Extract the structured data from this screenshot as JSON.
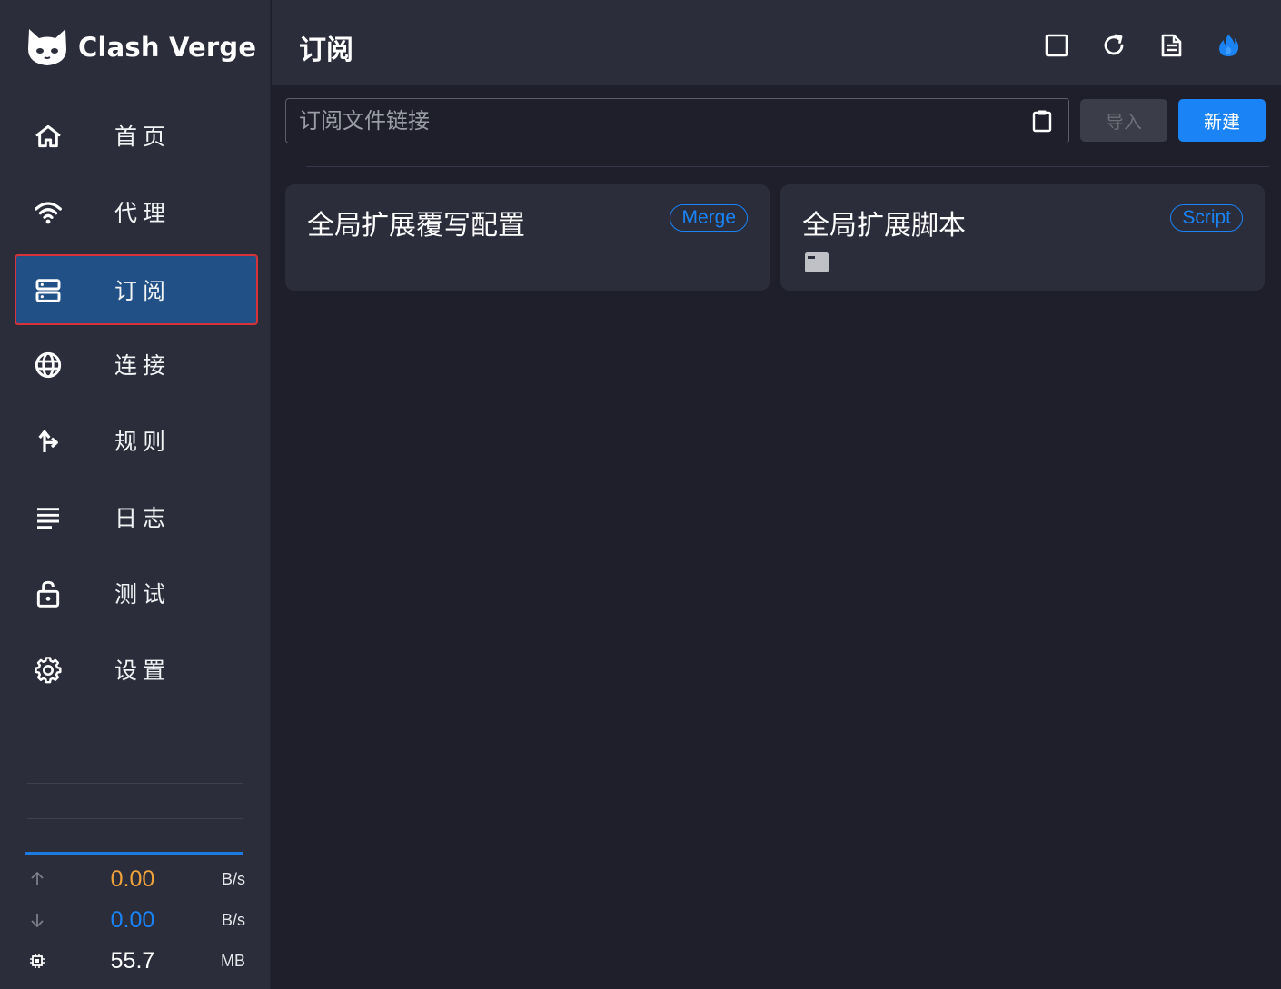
{
  "app": {
    "title": "Clash Verge"
  },
  "sidebar": {
    "items": [
      {
        "label": "首页",
        "icon": "home-icon"
      },
      {
        "label": "代理",
        "icon": "wifi-icon"
      },
      {
        "label": "订阅",
        "icon": "server-icon",
        "active": true
      },
      {
        "label": "连接",
        "icon": "globe-icon"
      },
      {
        "label": "规则",
        "icon": "fork-icon"
      },
      {
        "label": "日志",
        "icon": "list-icon"
      },
      {
        "label": "测试",
        "icon": "lock-open-icon"
      },
      {
        "label": "设置",
        "icon": "gear-icon"
      }
    ],
    "stats": {
      "upload": {
        "value": "0.00",
        "unit": "B/s",
        "color": "#f0a33b"
      },
      "download": {
        "value": "0.00",
        "unit": "B/s",
        "color": "#1a83f5"
      },
      "memory": {
        "value": "55.7",
        "unit": "MB"
      }
    }
  },
  "header": {
    "title": "订阅",
    "actions": [
      "square-icon",
      "refresh-icon",
      "document-icon",
      "fire-icon"
    ]
  },
  "toolbar": {
    "url_placeholder": "订阅文件链接",
    "url_value": "",
    "import_label": "导入",
    "new_label": "新建"
  },
  "cards": [
    {
      "title": "全局扩展覆写配置",
      "badge": "Merge"
    },
    {
      "title": "全局扩展脚本",
      "badge": "Script"
    }
  ],
  "colors": {
    "accent": "#1a83f5",
    "sidebar_bg": "#2b2d3b",
    "main_bg": "#1e1f2a",
    "active_bg": "#215087",
    "highlight_border": "#d8323a"
  }
}
